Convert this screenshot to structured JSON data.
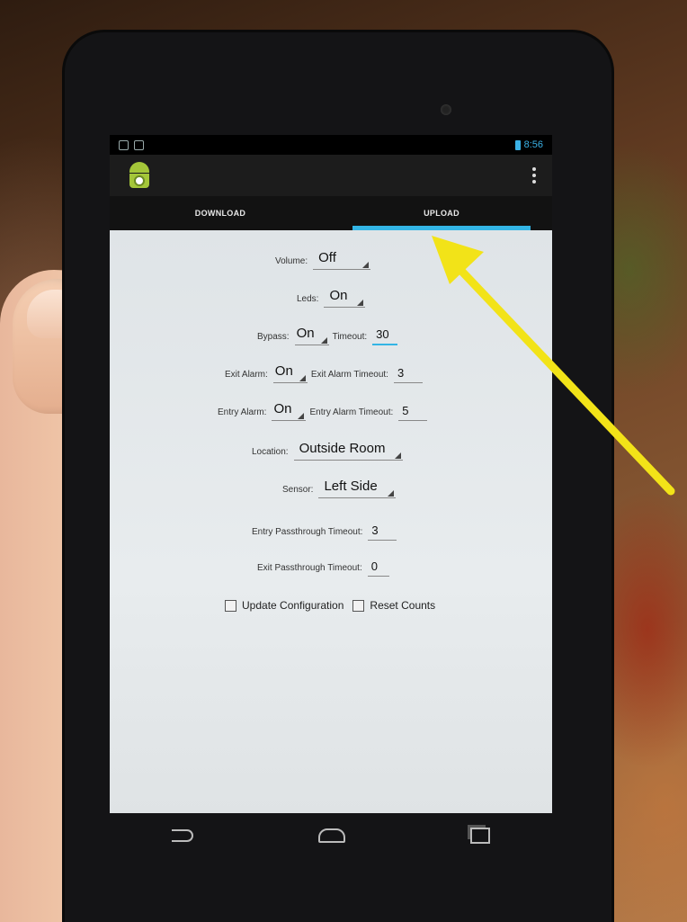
{
  "status_bar": {
    "time": "8:56"
  },
  "tabs": [
    {
      "label": "DOWNLOAD",
      "active": false
    },
    {
      "label": "UPLOAD",
      "active": true
    }
  ],
  "form": {
    "volume": {
      "label": "Volume:",
      "value": "Off"
    },
    "leds": {
      "label": "Leds:",
      "value": "On"
    },
    "bypass": {
      "label": "Bypass:",
      "value": "On",
      "timeout_label": "Timeout:",
      "timeout_value": "30"
    },
    "exit_alarm": {
      "label": "Exit Alarm:",
      "value": "On",
      "timeout_label": "Exit Alarm Timeout:",
      "timeout_value": "3"
    },
    "entry_alarm": {
      "label": "Entry Alarm:",
      "value": "On",
      "timeout_label": "Entry Alarm Timeout:",
      "timeout_value": "5"
    },
    "location": {
      "label": "Location:",
      "value": "Outside Room"
    },
    "sensor": {
      "label": "Sensor:",
      "value": "Left Side"
    },
    "entry_passthrough": {
      "label": "Entry Passthrough Timeout:",
      "value": "3"
    },
    "exit_passthrough": {
      "label": "Exit Passthrough Timeout:",
      "value": "0"
    },
    "update_configuration": {
      "label": "Update Configuration",
      "checked": false
    },
    "reset_counts": {
      "label": "Reset Counts",
      "checked": false
    }
  },
  "colors": {
    "accent": "#33b5e5",
    "arrow": "#f2e318",
    "android": "#a4c639"
  },
  "icons": [
    "android-app-icon",
    "overflow-menu-icon",
    "back-icon",
    "home-icon",
    "recent-apps-icon",
    "battery-icon"
  ]
}
